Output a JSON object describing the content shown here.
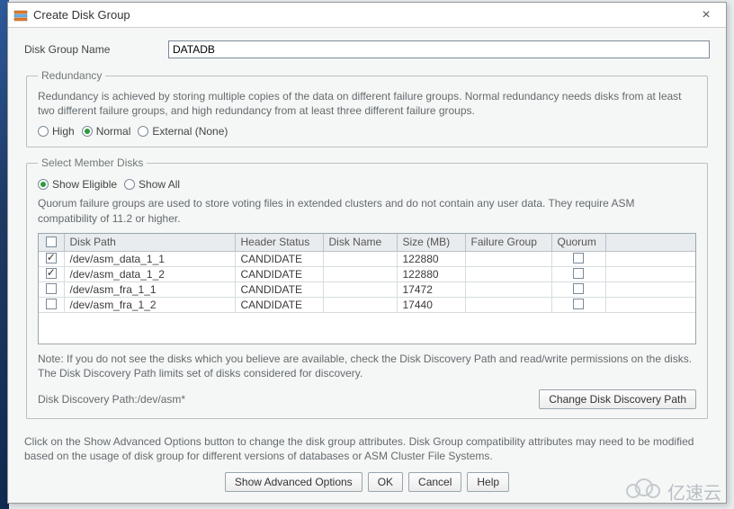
{
  "window": {
    "title": "Create Disk Group",
    "close_symbol": "×"
  },
  "disk_group_name": {
    "label": "Disk Group Name",
    "value": "DATADB"
  },
  "redundancy": {
    "legend": "Redundancy",
    "description": "Redundancy is achieved by storing multiple copies of the data on different failure groups. Normal redundancy needs disks from at least two different failure groups, and high redundancy from at least three different failure groups.",
    "options": {
      "high": "High",
      "normal": "Normal",
      "external": "External (None)"
    },
    "selected": "normal"
  },
  "member_disks": {
    "legend": "Select Member Disks",
    "show_options": {
      "eligible": "Show Eligible",
      "all": "Show All"
    },
    "show_selected": "eligible",
    "quorum_note": "Quorum failure groups are used to store voting files in extended clusters and do not contain any user data. They require ASM compatibility of 11.2 or higher.",
    "columns": {
      "disk_path": "Disk Path",
      "header_status": "Header Status",
      "disk_name": "Disk Name",
      "size_mb": "Size (MB)",
      "failure_group": "Failure Group",
      "quorum": "Quorum"
    },
    "rows": [
      {
        "checked": true,
        "disk_path": "/dev/asm_data_1_1",
        "header_status": "CANDIDATE",
        "disk_name": "",
        "size_mb": "122880",
        "failure_group": "",
        "quorum": false
      },
      {
        "checked": true,
        "disk_path": "/dev/asm_data_1_2",
        "header_status": "CANDIDATE",
        "disk_name": "",
        "size_mb": "122880",
        "failure_group": "",
        "quorum": false
      },
      {
        "checked": false,
        "disk_path": "/dev/asm_fra_1_1",
        "header_status": "CANDIDATE",
        "disk_name": "",
        "size_mb": "17472",
        "failure_group": "",
        "quorum": false
      },
      {
        "checked": false,
        "disk_path": "/dev/asm_fra_1_2",
        "header_status": "CANDIDATE",
        "disk_name": "",
        "size_mb": "17440",
        "failure_group": "",
        "quorum": false
      }
    ],
    "note": "Note: If you do not see the disks which you believe are available, check the Disk Discovery Path and read/write permissions on the disks. The Disk Discovery Path limits set of disks considered for discovery.",
    "discovery_path_label": "Disk Discovery Path:",
    "discovery_path_value": "/dev/asm*",
    "change_path_button": "Change Disk Discovery Path"
  },
  "footer_note": "Click on the Show Advanced Options button to change the disk group attributes. Disk Group compatibility attributes may need to be modified based on the usage of disk group for different versions of databases or ASM Cluster File Systems.",
  "buttons": {
    "advanced": "Show Advanced Options",
    "ok": "OK",
    "cancel": "Cancel",
    "help": "Help"
  },
  "watermark": "亿速云"
}
